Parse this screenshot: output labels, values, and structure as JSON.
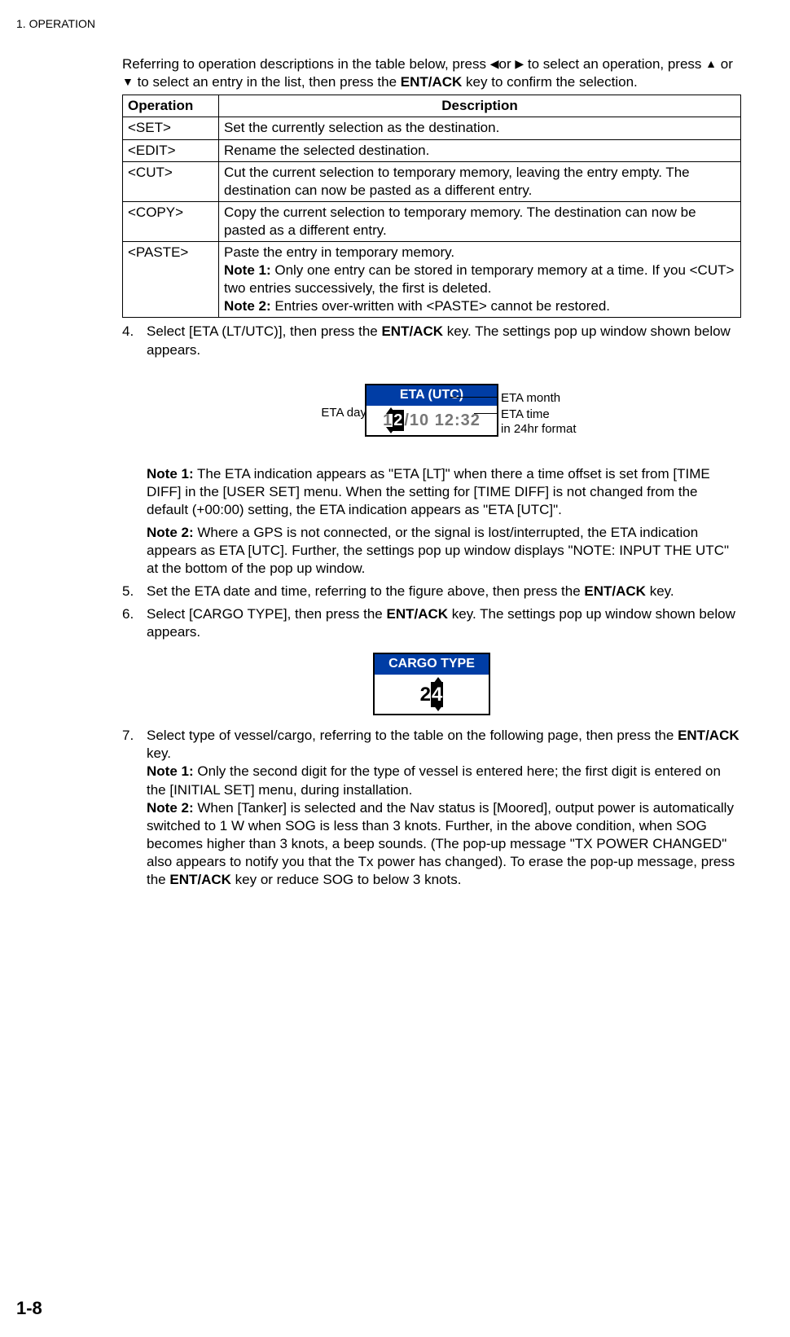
{
  "header": "1.  OPERATION",
  "intro": {
    "part1": "Referring to operation descriptions in the table below, press ",
    "glyph_l": "◀",
    "or1": "or ",
    "glyph_r": "▶",
    "part2": " to select an operation, press ",
    "glyph_u": "▲",
    "or2": " or ",
    "glyph_d": "▼",
    "part3": " to select an entry in the list, then press the ",
    "key": "ENT/ACK",
    "part4": " key to confirm the selection."
  },
  "table": {
    "h1": "Operation",
    "h2": "Description",
    "rows": [
      {
        "op": "<SET>",
        "desc": "Set the currently selection as the destination."
      },
      {
        "op": "<EDIT>",
        "desc": "Rename the selected destination."
      },
      {
        "op": "<CUT>",
        "desc": "Cut the current selection to temporary memory, leaving the entry empty. The destination can now be pasted as a different entry."
      },
      {
        "op": "<COPY>",
        "desc": "Copy the current selection to temporary memory. The destination can now be pasted as a different entry."
      },
      {
        "op": "<PASTE>",
        "p1": "Paste the entry in temporary memory.",
        "n1b": "Note 1:",
        "n1": " Only one entry can be stored in temporary memory at a time. If you <CUT> two entries successively, the first is deleted.",
        "n2b": "Note 2:",
        "n2": " Entries over-written with <PASTE> cannot be restored."
      }
    ]
  },
  "step4": {
    "num": "4.",
    "t1": "Select [ETA (LT/UTC)], then press the ",
    "key": "ENT/ACK",
    "t2": " key. The settings pop up window shown below appears."
  },
  "eta": {
    "title": "ETA (UTC)",
    "d_hl": "2",
    "d_pre": "1",
    "sep": " / ",
    "rest": "10 12:32",
    "label_day": "ETA day",
    "label_month": "ETA month",
    "label_time": "ETA time",
    "label_fmt": "in 24hr format"
  },
  "note1": {
    "b": "Note 1:",
    "t": " The ETA indication appears as \"ETA [LT]\" when there a time offset is set from [TIME DIFF] in the [USER SET] menu. When the setting for [TIME DIFF] is not changed from the default (+00:00) setting, the ETA indication appears as \"ETA [UTC]\"."
  },
  "note2": {
    "b": "Note 2:",
    "t": " Where a GPS is not connected, or the signal is lost/interrupted, the ETA indication appears as ETA [UTC]. Further, the settings pop up window displays \"NOTE: INPUT THE UTC\" at the bottom of the pop up window."
  },
  "step5": {
    "num": "5.",
    "t1": "Set the ETA date and time, referring to the figure above, then press the ",
    "key": "ENT/ACK",
    "t2": " key."
  },
  "step6": {
    "num": "6.",
    "t1": "Select [CARGO TYPE], then press the ",
    "key": "ENT/ACK",
    "t2": " key. The settings pop up window shown below appears."
  },
  "cargo": {
    "title": "CARGO TYPE",
    "d1": "2",
    "d2": "4"
  },
  "step7": {
    "num": "7.",
    "t1": "Select type of vessel/cargo, referring to the table on the following page, then press the ",
    "key": "ENT/ACK",
    "t2": " key.",
    "n1b": "Note 1:",
    "n1": " Only the second digit for the type of vessel is entered here; the first digit is entered on the [INITIAL SET] menu, during installation.",
    "n2b": "Note 2:",
    "n2a": " When [Tanker] is selected and the Nav status is [Moored], output power is automatically switched to 1 W when SOG is less than 3 knots. Further, in the above condition, when SOG becomes higher than 3 knots, a beep sounds. (The pop-up message \"TX POWER CHANGED\" also appears to notify you that the Tx power has changed). To erase the pop-up message, press the ",
    "key2": "ENT/ACK",
    "n2c": " key or reduce SOG to below 3 knots."
  },
  "pagenum": "1-8"
}
